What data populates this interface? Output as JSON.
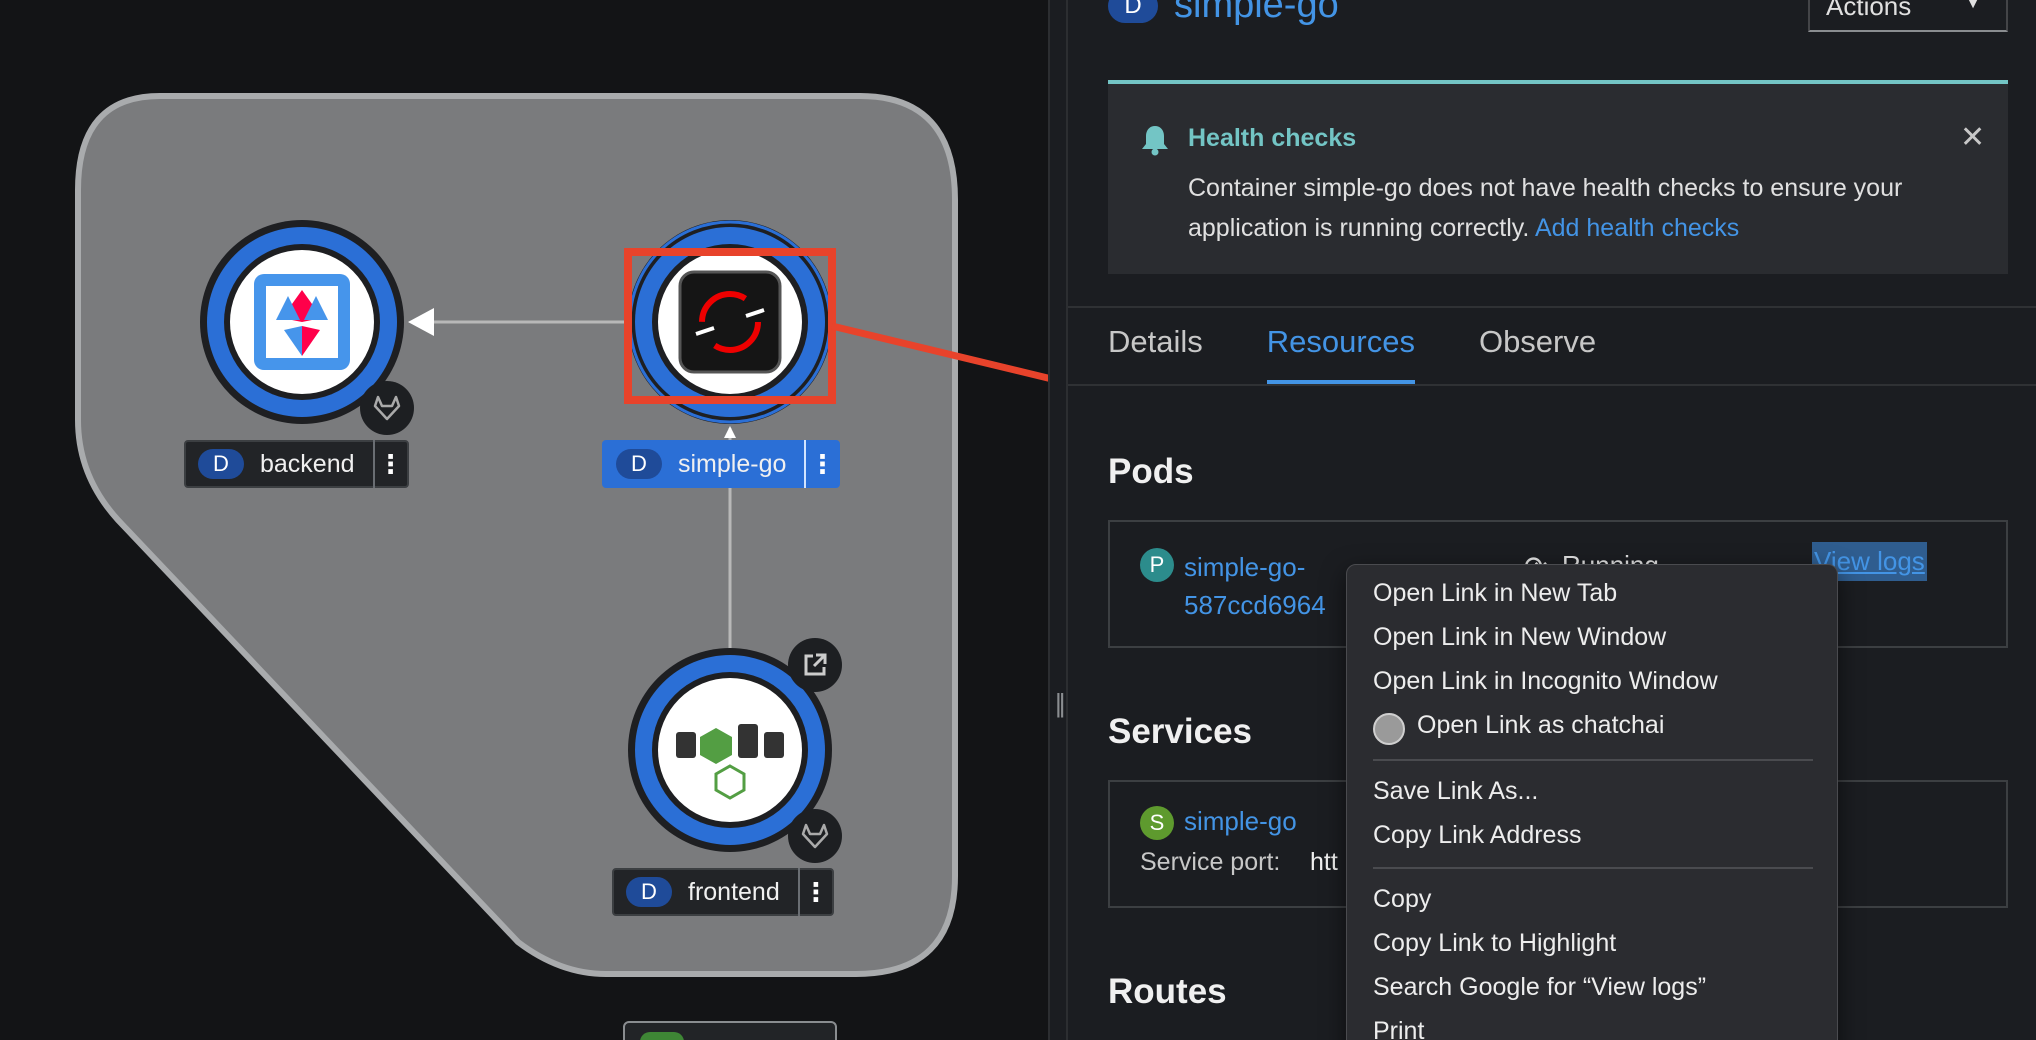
{
  "topology": {
    "nodes": [
      {
        "id": "backend",
        "kind_badge": "D",
        "name": "backend"
      },
      {
        "id": "simple-go",
        "kind_badge": "D",
        "name": "simple-go"
      },
      {
        "id": "frontend",
        "kind_badge": "D",
        "name": "frontend"
      }
    ],
    "icons": {
      "backend": "quarkus-logo",
      "simple-go": "openshift-logo",
      "frontend": "nodejs-logo",
      "git_badge": "gitlab-icon",
      "external_link": "external-link-icon"
    }
  },
  "panel": {
    "resource_badge": "D",
    "resource_name": "simple-go",
    "actions_label": "Actions",
    "alert": {
      "title": "Health checks",
      "body": "Container simple-go does not have health checks to ensure your application is running correctly.",
      "link": "Add health checks"
    },
    "tabs": [
      "Details",
      "Resources",
      "Observe"
    ],
    "active_tab": "Resources",
    "pods": {
      "heading": "Pods",
      "badge": "P",
      "name_line1": "simple-go-",
      "name_line2": "587ccd6964",
      "status": "Running",
      "view_logs": "View logs"
    },
    "services": {
      "heading": "Services",
      "badge": "S",
      "name": "simple-go",
      "port_label": "Service port:",
      "port_value": "htt"
    },
    "routes": {
      "heading": "Routes"
    }
  },
  "context_menu": {
    "items": [
      "Open Link in New Tab",
      "Open Link in New Window",
      "Open Link in Incognito Window",
      "Open Link as chatchai",
      "Save Link As...",
      "Copy Link Address",
      "Copy",
      "Copy Link to Highlight",
      "Search Google for “View logs”",
      "Print"
    ]
  },
  "colors": {
    "accent_blue": "#4394e5",
    "node_ring": "#2b6fd6",
    "annotation_red": "#e8432b",
    "alert_teal": "#73c5c5"
  }
}
